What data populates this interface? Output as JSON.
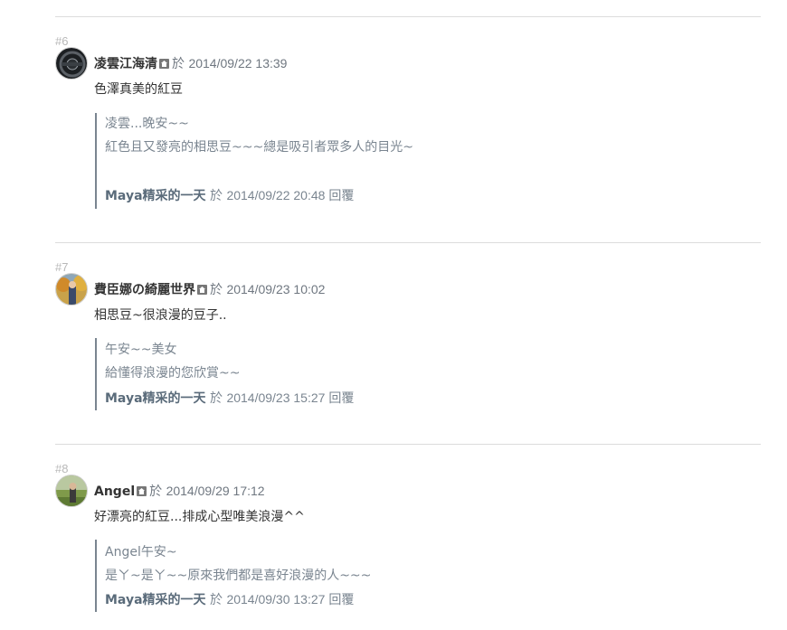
{
  "comments": [
    {
      "number": "#6",
      "author": "凌雲江海清",
      "sep": "於",
      "date": "2014/09/22 13:39",
      "text": "色澤真美的紅豆",
      "reply": {
        "lines": [
          "凌雲...晚安~~",
          "紅色且又發亮的相思豆~~~總是吸引者眾多人的目光~"
        ],
        "replier": "Maya精采的一天",
        "sep": "於",
        "date": "2014/09/22 20:48 回覆"
      }
    },
    {
      "number": "#7",
      "author": "費臣娜の綺麗世界",
      "sep": "於",
      "date": "2014/09/23 10:02",
      "text": "相思豆~很浪漫的豆子..",
      "reply": {
        "lines": [
          "午安~~美女",
          "給懂得浪漫的您欣賞~~"
        ],
        "replier": "Maya精采的一天",
        "sep": "於",
        "date": "2014/09/23 15:27 回覆"
      }
    },
    {
      "number": "#8",
      "author": "Angel",
      "sep": "於",
      "date": "2014/09/29 17:12",
      "text": "好漂亮的紅豆...排成心型唯美浪漫^^",
      "reply": {
        "lines": [
          "Angel午安~",
          "是ㄚ~是ㄚ~~原來我們都是喜好浪漫的人~~~"
        ],
        "replier": "Maya精采的一天",
        "sep": "於",
        "date": "2014/09/30 13:27 回覆"
      }
    }
  ]
}
